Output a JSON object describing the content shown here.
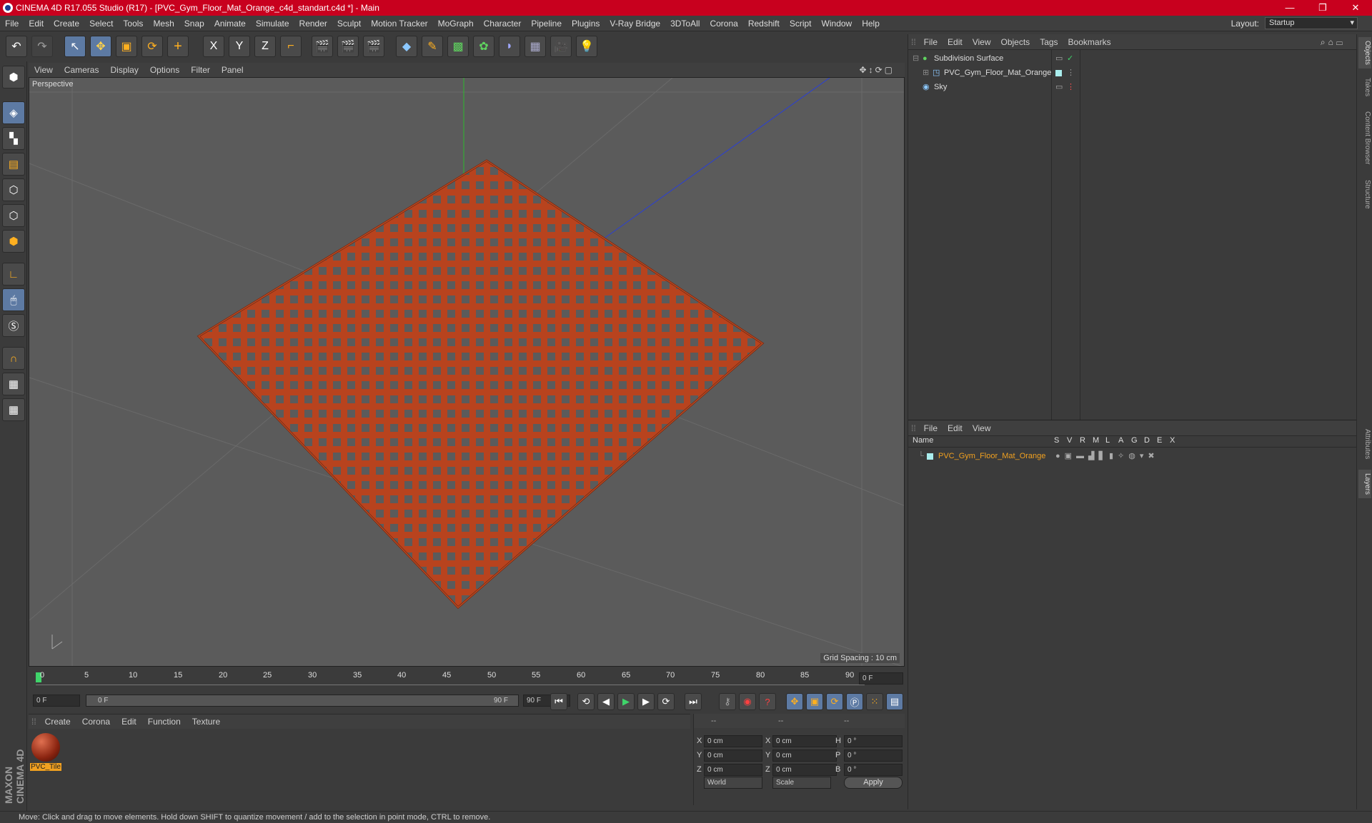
{
  "window": {
    "title": "CINEMA 4D R17.055 Studio (R17) - [PVC_Gym_Floor_Mat_Orange_c4d_standart.c4d *] - Main",
    "minimize": "—",
    "maximize": "❐",
    "close": "✕"
  },
  "menubar": {
    "items": [
      "File",
      "Edit",
      "Create",
      "Select",
      "Tools",
      "Mesh",
      "Snap",
      "Animate",
      "Simulate",
      "Render",
      "Sculpt",
      "Motion Tracker",
      "MoGraph",
      "Character",
      "Pipeline",
      "Plugins",
      "V-Ray Bridge",
      "3DToAll",
      "Corona",
      "Redshift",
      "Script",
      "Window",
      "Help"
    ],
    "layout_label": "Layout:",
    "layout_value": "Startup"
  },
  "toolbar": {
    "undo": "↶",
    "redo": "↷",
    "select": "↖",
    "move": "✥",
    "scale": "▣",
    "rotate": "⟳",
    "add": "+",
    "x": "X",
    "y": "Y",
    "z": "Z",
    "coord": "⌐"
  },
  "viewport": {
    "menu": [
      "View",
      "Cameras",
      "Display",
      "Options",
      "Filter",
      "Panel"
    ],
    "camera_label": "Perspective",
    "grid_spacing": "Grid Spacing : 10 cm",
    "mat_color": "#b8431e"
  },
  "timeline": {
    "ticks": [
      "0",
      "5",
      "10",
      "15",
      "20",
      "25",
      "30",
      "35",
      "40",
      "45",
      "50",
      "55",
      "60",
      "65",
      "70",
      "75",
      "80",
      "85",
      "90"
    ],
    "current_frame": "0 F",
    "start_field": "0 F",
    "range_start": "0 F",
    "range_end": "90 F",
    "end_field": "90 F"
  },
  "material_panel": {
    "menu": [
      "Create",
      "Corona",
      "Edit",
      "Function",
      "Texture"
    ],
    "material_name": "PVC_Tile"
  },
  "coords": {
    "header": [
      "--",
      "--",
      "--"
    ],
    "labels_pos": [
      "X",
      "Y",
      "Z"
    ],
    "labels_size": [
      "X",
      "Y",
      "Z"
    ],
    "labels_rot": [
      "H",
      "P",
      "B"
    ],
    "pos_values": [
      "0 cm",
      "0 cm",
      "0 cm"
    ],
    "size_values": [
      "0 cm",
      "0 cm",
      "0 cm"
    ],
    "rot_values": [
      "0 °",
      "0 °",
      "0 °"
    ],
    "mode1": "World",
    "mode2": "Scale",
    "apply": "Apply"
  },
  "object_manager": {
    "menu": [
      "File",
      "Edit",
      "View",
      "Objects",
      "Tags",
      "Bookmarks"
    ],
    "objects": [
      {
        "name": "Subdivision Surface",
        "indent": 0
      },
      {
        "name": "PVC_Gym_Floor_Mat_Orange",
        "indent": 1
      },
      {
        "name": "Sky",
        "indent": 0
      }
    ]
  },
  "layer_manager": {
    "menu": [
      "File",
      "Edit",
      "View"
    ],
    "columns": [
      "Name",
      "S",
      "V",
      "R",
      "M",
      "L",
      "A",
      "G",
      "D",
      "E",
      "X"
    ],
    "layer_name": "PVC_Gym_Floor_Mat_Orange",
    "layer_color": "#f0a020"
  },
  "right_tabs": [
    "Objects",
    "Takes",
    "Content Browser",
    "Structure",
    "Attributes",
    "Layers"
  ],
  "brand": "MAXON CINEMA 4D",
  "status": "Move: Click and drag to move elements. Hold down SHIFT to quantize movement / add to the selection in point mode, CTRL to remove."
}
